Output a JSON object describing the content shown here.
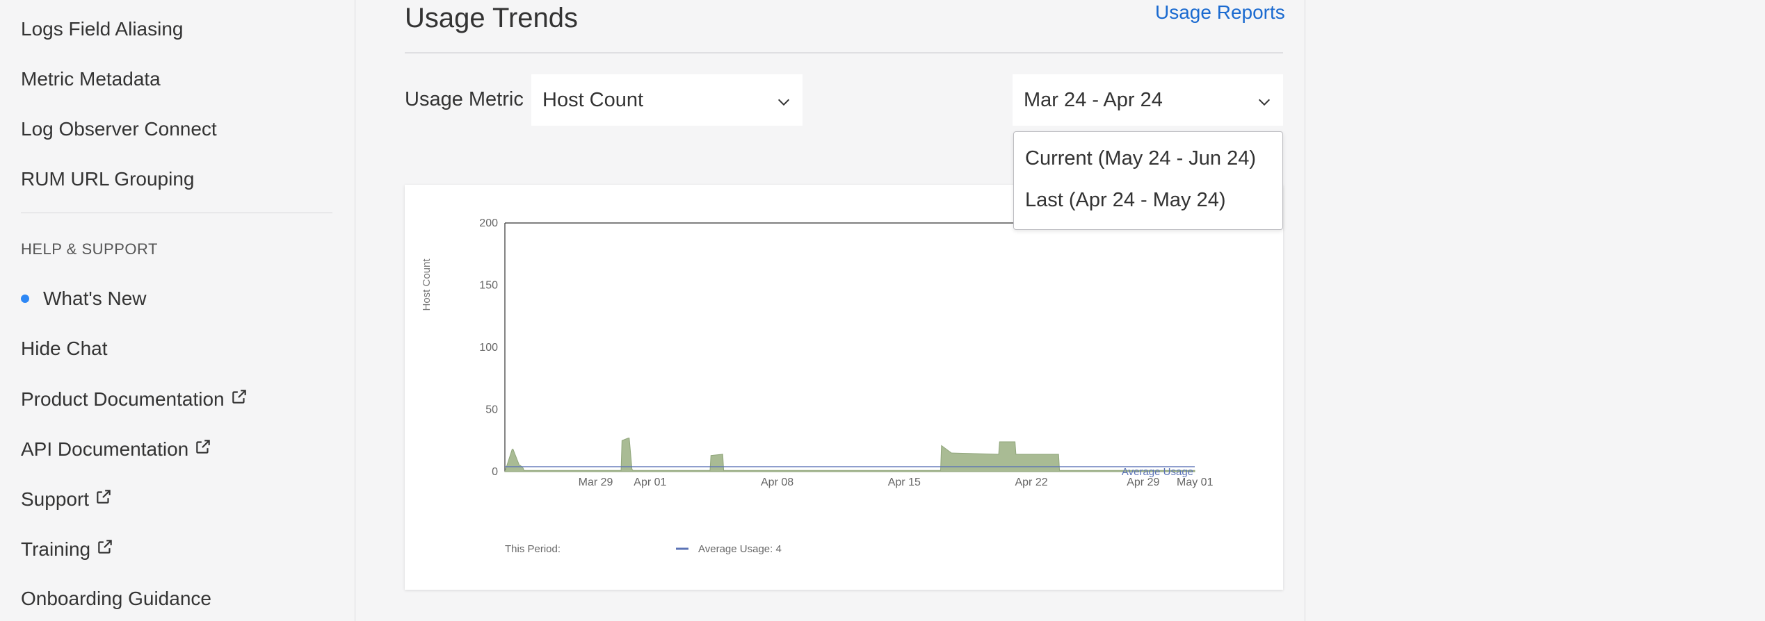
{
  "sidebar": {
    "items": [
      {
        "label": "Logs Field Aliasing"
      },
      {
        "label": "Metric Metadata"
      },
      {
        "label": "Log Observer Connect"
      },
      {
        "label": "RUM URL Grouping"
      }
    ],
    "help_header": "HELP & SUPPORT",
    "help_items": [
      {
        "label": "What's New",
        "icon": "blue-dot-icon"
      },
      {
        "label": "Hide Chat"
      },
      {
        "label": "Product Documentation",
        "icon": "external-link-icon"
      },
      {
        "label": "API Documentation",
        "icon": "external-link-icon"
      },
      {
        "label": "Support",
        "icon": "external-link-icon"
      },
      {
        "label": "Training",
        "icon": "external-link-icon"
      },
      {
        "label": "Onboarding Guidance"
      }
    ]
  },
  "main": {
    "title": "Usage Trends",
    "usage_reports_link": "Usage Reports",
    "usage_metric_label": "Usage Metric",
    "metric_select_value": "Host Count",
    "date_select_value": "Mar 24 - Apr 24",
    "date_options": [
      "Current (May 24 - Jun 24)",
      "Last (Apr 24 - May 24)"
    ]
  },
  "colors": {
    "accent_link": "#1a6ad0",
    "area_fill": "#a9bb94",
    "average_line": "#5b73b6",
    "dot_blue": "#2d87f5"
  },
  "chart_data": {
    "type": "area",
    "ylabel": "Host Count",
    "ylim": [
      0,
      200
    ],
    "yticks": [
      0,
      50,
      100,
      150,
      200
    ],
    "xtick_labels": [
      "Mar 29",
      "Apr 01",
      "Apr 08",
      "Apr 15",
      "Apr 22",
      "Apr 29",
      "May 01"
    ],
    "xtick_days": [
      5,
      8,
      15,
      22,
      29,
      36,
      38
    ],
    "x_range_days": [
      0,
      38
    ],
    "series": [
      {
        "name": "This Period:",
        "x": [
          0,
          0.4,
          0.45,
          0.8,
          0.85,
          1.0,
          1.05,
          6.4,
          6.45,
          6.8,
          6.85,
          7.0,
          7.05,
          11.3,
          11.35,
          12.0,
          12.05,
          24.0,
          24.05,
          24.6,
          24.65,
          27.2,
          27.25,
          28.1,
          28.15,
          30.5,
          30.55,
          38
        ],
        "values": [
          0,
          18,
          18,
          5,
          5,
          3,
          1,
          1,
          25,
          27,
          27,
          2,
          1,
          1,
          13,
          14,
          1,
          1,
          21,
          15,
          15,
          14,
          24,
          24,
          14,
          14,
          1,
          1
        ]
      },
      {
        "name": "Average Usage",
        "constant": 4,
        "legend_label": "Average Usage: 4"
      }
    ],
    "annotation": "Average Usage",
    "legend_placement": "bottom-left"
  }
}
